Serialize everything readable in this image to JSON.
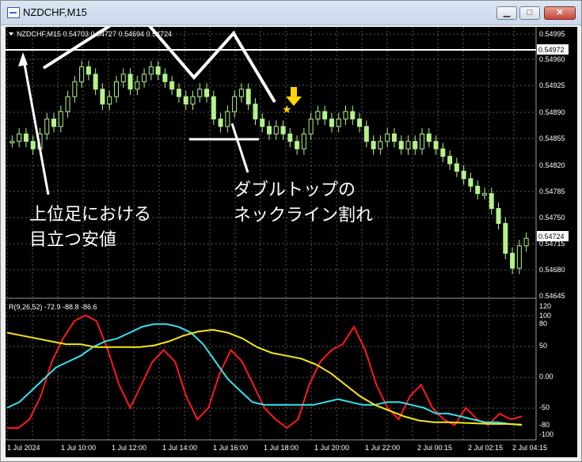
{
  "window": {
    "title": "NZDCHF,M15",
    "minimize_glyph": "▁",
    "maximize_glyph": "□",
    "close_glyph": "✕"
  },
  "chart": {
    "symbol_header": "NZDCHF,M15  0.54703 0.54727 0.54694 0.54724",
    "price_ticks": [
      "0.54995",
      "0.54960",
      "0.54925",
      "0.54890",
      "0.54855",
      "0.54820",
      "0.54785",
      "0.54750",
      "0.54715",
      "0.54680",
      "0.54645"
    ],
    "price_label_upper": "0.54972",
    "price_label_current": "0.54724",
    "time_ticks": [
      "1 Jul 2024",
      "1 Jul 10:00",
      "1 Jul 12:00",
      "1 Jul 14:00",
      "1 Jul 16:00",
      "1 Jul 18:00",
      "1 Jul 20:00",
      "1 Jul 22:00",
      "2 Jul 00:15",
      "2 Jul 02:15",
      "2 Jul 04:15"
    ],
    "indicator_header": "R(9,26,52) -72.9 -88.8 -86.6",
    "indicator_ticks": [
      "120",
      "100",
      "80",
      "50",
      "0.00",
      "-50",
      "-80",
      "-100"
    ],
    "annotation_left_line1": "上位足における",
    "annotation_left_line2": "目立つ安値",
    "annotation_right_line1": "ダブルトップの",
    "annotation_right_line2": "ネックライン割れ",
    "colors": {
      "background": "#000000",
      "grid": "#5a5a5a",
      "candle": "#b5f28a",
      "line_red": "#ff1a1a",
      "line_cyan": "#33e4f0",
      "line_yellow": "#f5e61a",
      "arrow_yellow": "#ffd400",
      "annotation": "#ffffff"
    }
  },
  "chart_data": {
    "type": "candlestick",
    "price_axis_range": [
      0.54645,
      0.54995
    ],
    "marked_price": 0.54972,
    "last_price": 0.54724,
    "close_series": [
      0.5485,
      0.5486,
      0.5485,
      0.5484,
      0.5486,
      0.5488,
      0.5487,
      0.5489,
      0.5491,
      0.5493,
      0.5495,
      0.5494,
      0.5492,
      0.549,
      0.5491,
      0.5493,
      0.5494,
      0.5492,
      0.5493,
      0.5494,
      0.5495,
      0.5494,
      0.5493,
      0.5492,
      0.5491,
      0.549,
      0.5491,
      0.5492,
      0.5491,
      0.5488,
      0.5487,
      0.5489,
      0.5491,
      0.5492,
      0.549,
      0.5488,
      0.5487,
      0.5486,
      0.5487,
      0.5486,
      0.5485,
      0.5484,
      0.5486,
      0.5488,
      0.5489,
      0.5488,
      0.5487,
      0.5488,
      0.5489,
      0.5488,
      0.5487,
      0.5485,
      0.5484,
      0.5485,
      0.5486,
      0.5485,
      0.5484,
      0.5485,
      0.5484,
      0.5486,
      0.5485,
      0.5484,
      0.5483,
      0.5482,
      0.5481,
      0.548,
      0.5479,
      0.5478,
      0.5478,
      0.5476,
      0.5474,
      0.547,
      0.5468,
      0.5471,
      0.5472
    ],
    "indicator_series": [
      {
        "color": "red",
        "values": [
          -95,
          -95,
          -80,
          -40,
          20,
          60,
          90,
          100,
          90,
          40,
          -20,
          -60,
          -20,
          20,
          40,
          20,
          -40,
          -80,
          -60,
          0,
          40,
          20,
          -20,
          -60,
          -80,
          -95,
          -80,
          -20,
          20,
          40,
          50,
          80,
          40,
          -20,
          -60,
          -80,
          -40,
          -20,
          -60,
          -80,
          -90,
          -60,
          -80,
          -90,
          -70,
          -80,
          -75
        ]
      },
      {
        "color": "cyan",
        "values": [
          -60,
          -50,
          -30,
          -10,
          10,
          20,
          30,
          45,
          55,
          60,
          70,
          80,
          85,
          85,
          80,
          70,
          50,
          20,
          -10,
          -30,
          -50,
          -55,
          -55,
          -55,
          -55,
          -55,
          -50,
          -45,
          -50,
          -55,
          -55,
          -50,
          -50,
          -55,
          -60,
          -70,
          -70,
          -75,
          -80,
          -85,
          -85,
          -88,
          -90
        ]
      },
      {
        "color": "yellow",
        "values": [
          70,
          65,
          60,
          55,
          50,
          50,
          45,
          45,
          45,
          45,
          48,
          55,
          65,
          72,
          75,
          70,
          60,
          45,
          35,
          30,
          25,
          15,
          0,
          -20,
          -40,
          -55,
          -65,
          -75,
          -82,
          -85,
          -85,
          -86,
          -87,
          -88,
          -88,
          -89
        ]
      }
    ],
    "indicator_axis_range": [
      -110,
      120
    ]
  }
}
